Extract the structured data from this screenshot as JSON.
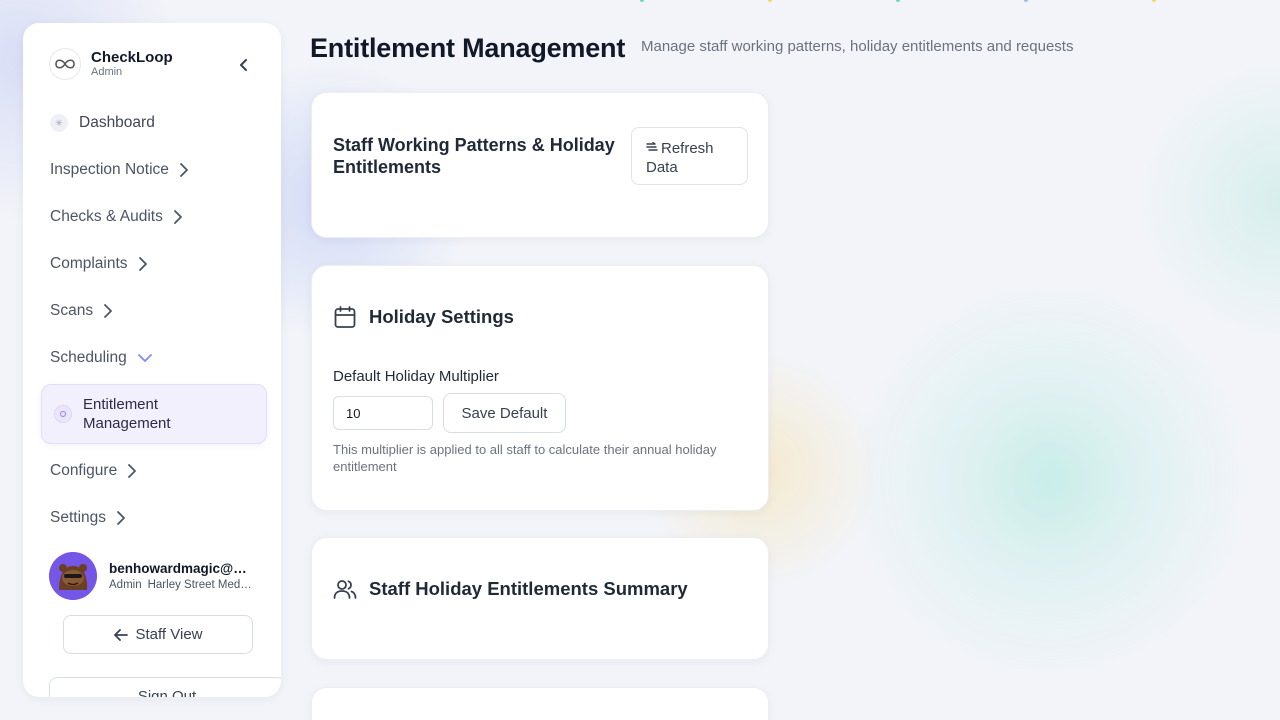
{
  "colors": {
    "accent": "#7c5cf0",
    "active_bg": "#f3f0fd",
    "text": "#1f2937",
    "muted": "#6b7280"
  },
  "sidebar": {
    "brand": {
      "name": "CheckLoop",
      "role": "Admin",
      "icon": "infinity-logo-icon"
    },
    "items": [
      {
        "label": "Dashboard",
        "icon": "dashboard-dot-icon"
      },
      {
        "label": "Inspection Notice",
        "icon": "chevron-right-icon"
      },
      {
        "label": "Checks & Audits",
        "icon": "chevron-right-icon"
      },
      {
        "label": "Complaints",
        "icon": "chevron-right-icon"
      },
      {
        "label": "Scans",
        "icon": "chevron-right-icon"
      },
      {
        "label": "Scheduling",
        "icon": "chevron-down-icon"
      },
      {
        "label": "Entitlement Management",
        "icon": "circle-dot-icon",
        "active": true
      },
      {
        "label": "Configure",
        "icon": "chevron-right-icon"
      },
      {
        "label": "Settings",
        "icon": "chevron-right-icon"
      }
    ],
    "user": {
      "email": "benhowardmagic@hotmail.com",
      "role": "Admin",
      "site": "Harley Street Medical"
    },
    "staff_view_label": "Staff View",
    "sign_out_label": "Sign Out"
  },
  "header": {
    "title": "Entitlement Management",
    "subtitle": "Manage staff working patterns, holiday entitlements and requests"
  },
  "cards": {
    "patterns": {
      "title": "Staff Working Patterns & Holiday Entitlements",
      "refresh_label": "Refresh Data"
    },
    "holiday_settings": {
      "title": "Holiday Settings",
      "field_label": "Default Holiday Multiplier",
      "multiplier_value": "10",
      "save_label": "Save Default",
      "help_text": "This multiplier is applied to all staff to calculate their annual holiday entitlement"
    },
    "summary": {
      "title": "Staff Holiday Entitlements Summary"
    }
  }
}
